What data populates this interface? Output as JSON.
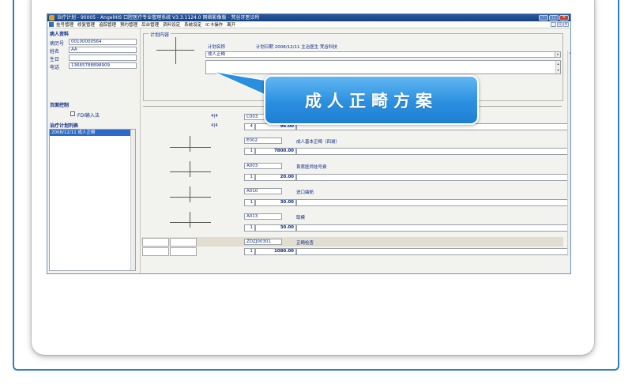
{
  "window": {
    "title": "治疗计划 - 90005 - AngelHIS 口腔医疗专业管理系统 V3.3.1124.0 网络影像版 - 梵谷牙医诊所",
    "minimize": "–",
    "maximize": "□",
    "close": "×"
  },
  "menu": {
    "items": [
      "挂号管理",
      "修复管理",
      "追踪管理",
      "预约管理",
      "后台管理",
      "资料设定",
      "系统设定",
      "IC卡操作",
      "离开"
    ],
    "mdi_min": "_",
    "mdi_max": "▫",
    "mdi_close": "×"
  },
  "patient": {
    "section_title": "病人资料",
    "record_no_label": "病历号",
    "record_no": "00100000564",
    "name_label": "姓名",
    "name": "AA",
    "birthday_label": "生日",
    "birthday": "",
    "phone_label": "电话",
    "phone": "13665788898909"
  },
  "display_control": {
    "title": "页面控制",
    "fdi_label": "FDI输入法"
  },
  "plan_list": {
    "title": "治疗计划列表",
    "rows": [
      {
        "text": "2008/12/11  成人正畸"
      }
    ]
  },
  "plan_content": {
    "legend": "计划内容",
    "name_label": "计划名称",
    "date_label": "计划日期 2008/12/11  主治医生 梵谷科技",
    "plan_name": "成人正畸",
    "combo_arrow": "▾",
    "scroll_up": "▴",
    "scroll_down": "▾"
  },
  "items": [
    {
      "teeth_top": "4|4",
      "teeth_bottom": "4|4",
      "code": "C003",
      "name": "",
      "qty": "4",
      "price": "96.00"
    },
    {
      "code": "E002",
      "name": "成人基本正畸（四谢）",
      "qty": "1",
      "price": "7800.00"
    },
    {
      "code": "A003",
      "name": "首席医师挂号费",
      "qty": "1",
      "price": "20.00"
    },
    {
      "code": "A010",
      "name": "进口曲舫",
      "qty": "1",
      "price": "30.00"
    },
    {
      "code": "A013",
      "name": "取模",
      "qty": "1",
      "price": "30.00"
    },
    {
      "code": "ZDZJ00301",
      "name": "正畸检查",
      "qty": "1",
      "price": "1080.00"
    }
  ],
  "callout": {
    "text": "成人正畸方案"
  },
  "colors": {
    "frame_blue": "#2f7ec4",
    "callout_blue": "#2b8fe0",
    "title_bar": "#173f7d",
    "list_selection": "#2c6ac7",
    "text_blue": "#0d2b86"
  }
}
